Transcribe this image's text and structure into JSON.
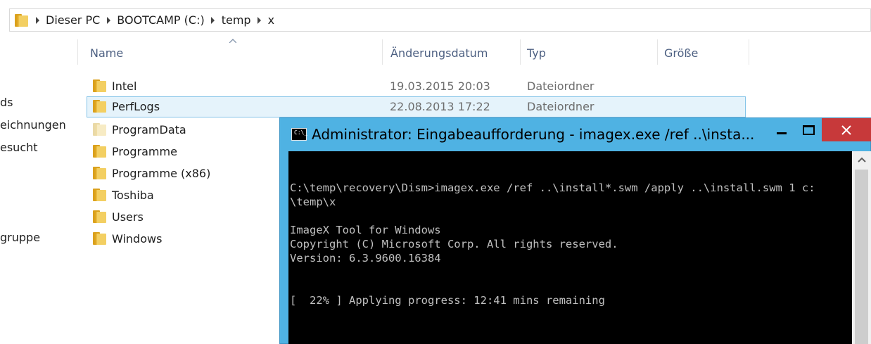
{
  "explorer": {
    "breadcrumb": [
      "Dieser PC",
      "BOOTCAMP (C:)",
      "temp",
      "x"
    ],
    "nav_items": [
      "ds",
      "eichnungen",
      "esucht",
      "gruppe"
    ],
    "columns": {
      "name": "Name",
      "date": "Änderungsdatum",
      "type": "Typ",
      "size": "Größe"
    },
    "rows": [
      {
        "name": "Intel",
        "date": "19.03.2015 20:03",
        "type": "Dateiordner"
      },
      {
        "name": "PerfLogs",
        "date": "22.08.2013 17:22",
        "type": "Dateiordner"
      },
      {
        "name": "ProgramData",
        "date": "",
        "type": ""
      },
      {
        "name": "Programme",
        "date": "",
        "type": ""
      },
      {
        "name": "Programme (x86)",
        "date": "",
        "type": ""
      },
      {
        "name": "Toshiba",
        "date": "",
        "type": ""
      },
      {
        "name": "Users",
        "date": "",
        "type": ""
      },
      {
        "name": "Windows",
        "date": "",
        "type": ""
      }
    ]
  },
  "console": {
    "title": "Administrator: Eingabeaufforderung - imagex.exe  /ref ..\\insta...",
    "icon_label": "C:\\_",
    "lines": [
      "C:\\temp\\recovery\\Dism>imagex.exe /ref ..\\install*.swm /apply ..\\install.swm 1 c:",
      "\\temp\\x",
      "ImageX Tool for Windows",
      "Copyright (C) Microsoft Corp. All rights reserved.",
      "Version: 6.3.9600.16384",
      "[  22% ] Applying progress: 12:41 mins remaining"
    ]
  },
  "colors": {
    "console_frame": "#4fb2e3",
    "close_button": "#c7393a",
    "selection_bg": "#e5f3fb",
    "selection_border": "#84c3e8",
    "header_text": "#4d6082"
  }
}
